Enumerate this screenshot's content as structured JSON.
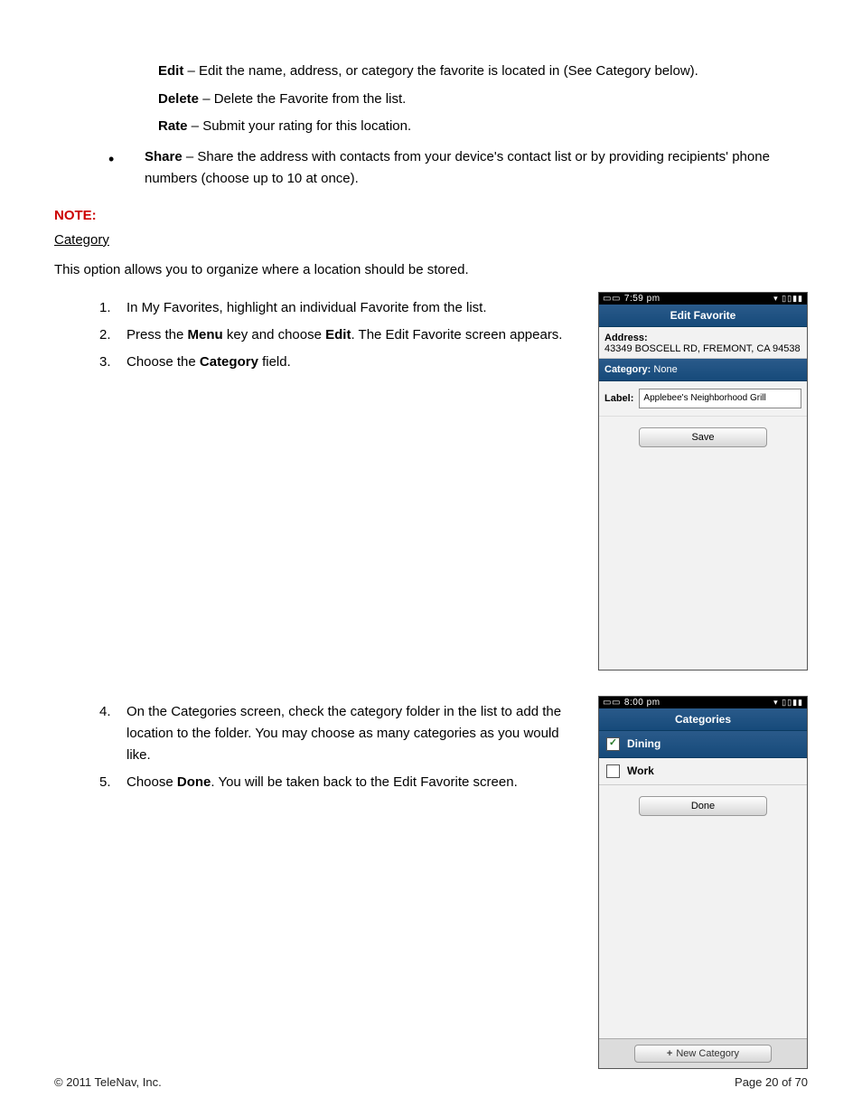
{
  "defs": {
    "edit": {
      "term": "Edit",
      "desc": " – Edit the name, address, or category the favorite is located in (See Category below)."
    },
    "delete": {
      "term": "Delete",
      "desc": " – Delete the Favorite from the list."
    },
    "rate": {
      "term": "Rate",
      "desc": " – Submit your rating for this location."
    }
  },
  "share": {
    "term": "Share",
    "desc": " – Share the address with contacts from your device's contact list or by providing recipients' phone numbers (choose up to 10 at once)."
  },
  "note_label": "NOTE:",
  "category_heading": "Category",
  "intro": "This option allows you to organize where a location should be stored.",
  "steps_a": {
    "s1": {
      "num": "1.",
      "text": "In My Favorites, highlight an individual Favorite from the list."
    },
    "s2": {
      "num": "2.",
      "pre": "Press the ",
      "b1": "Menu",
      "mid": " key and choose ",
      "b2": "Edit",
      "post": ". The Edit Favorite screen appears."
    },
    "s3": {
      "num": "3.",
      "pre": "Choose the ",
      "b1": "Category",
      "post": " field."
    }
  },
  "steps_b": {
    "s4": {
      "num": "4.",
      "text": "On the Categories screen, check the category folder in the list to add the location to the folder. You may choose as many categories as you would like."
    },
    "s5": {
      "num": "5.",
      "pre": "Choose ",
      "b1": "Done",
      "post": ". You will be taken back to the Edit Favorite screen."
    }
  },
  "phone1": {
    "status_time": "7:59 pm",
    "title": "Edit Favorite",
    "addr_label": "Address:",
    "addr_value": "43349 BOSCELL RD, FREMONT, CA 94538",
    "cat_label": "Category:",
    "cat_value": " None",
    "label_label": "Label:",
    "label_value": "Applebee's Neighborhood Grill",
    "save_btn": "Save"
  },
  "phone2": {
    "status_time": "8:00 pm",
    "title": "Categories",
    "item1": "Dining",
    "item1_check": "✓",
    "item2": "Work",
    "done_btn": "Done",
    "new_cat_btn": "New Category"
  },
  "footer": {
    "copyright": "© 2011 TeleNav, Inc.",
    "page": "Page 20 of 70"
  }
}
